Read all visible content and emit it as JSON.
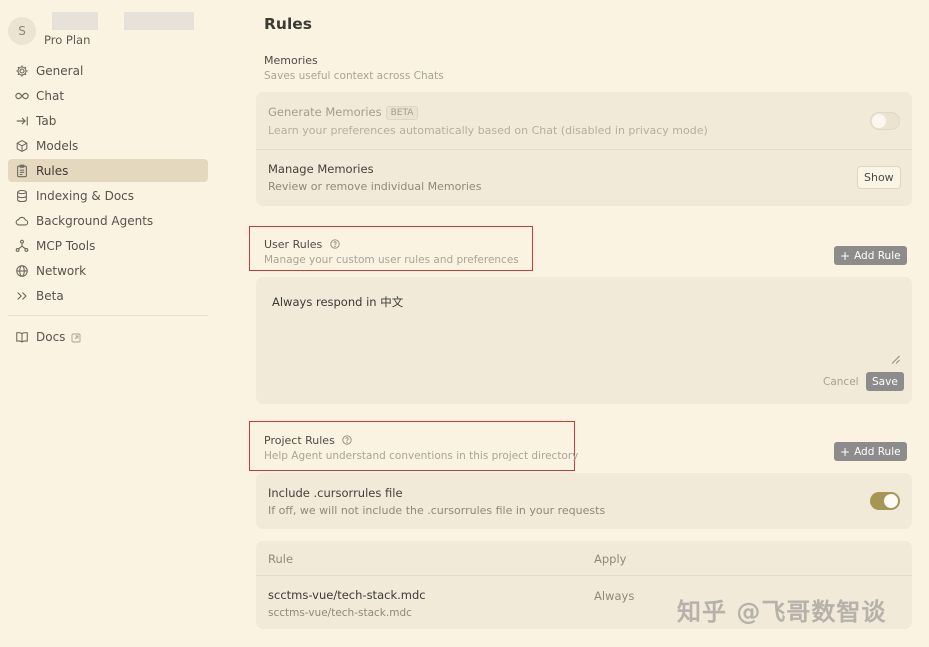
{
  "sidebar": {
    "avatar_letter": "S",
    "plan": "Pro Plan",
    "items": [
      {
        "label": "General",
        "icon": "gear-icon"
      },
      {
        "label": "Chat",
        "icon": "infinity-icon"
      },
      {
        "label": "Tab",
        "icon": "arrow-right-bar-icon"
      },
      {
        "label": "Models",
        "icon": "cube-icon"
      },
      {
        "label": "Rules",
        "icon": "clipboard-icon",
        "active": true
      },
      {
        "label": "Indexing & Docs",
        "icon": "database-icon"
      },
      {
        "label": "Background Agents",
        "icon": "cloud-icon"
      },
      {
        "label": "MCP Tools",
        "icon": "network-nodes-icon"
      },
      {
        "label": "Network",
        "icon": "globe-icon"
      },
      {
        "label": "Beta",
        "icon": "double-chevron-right-icon"
      }
    ],
    "docs_label": "Docs"
  },
  "page_title": "Rules",
  "memories": {
    "title": "Memories",
    "desc": "Saves useful context across Chats",
    "generate_title": "Generate Memories",
    "generate_badge": "BETA",
    "generate_desc": "Learn your preferences automatically based on Chat (disabled in privacy mode)",
    "generate_enabled": false,
    "manage_title": "Manage Memories",
    "manage_desc": "Review or remove individual Memories",
    "show_label": "Show"
  },
  "user_rules": {
    "title": "User Rules",
    "desc": "Manage your custom user rules and preferences",
    "add_label": "Add Rule",
    "content": "Always respond in 中文",
    "cancel_label": "Cancel",
    "save_label": "Save"
  },
  "project_rules": {
    "title": "Project Rules",
    "desc": "Help Agent understand conventions in this project directory",
    "add_label": "Add Rule",
    "include_title": "Include .cursorrules file",
    "include_desc": "If off, we will not include the .cursorrules file in your requests",
    "include_enabled": true,
    "table": {
      "col_rule": "Rule",
      "col_apply": "Apply",
      "rows": [
        {
          "name": "scctms-vue/tech-stack.mdc",
          "path": "scctms-vue/tech-stack.mdc",
          "apply": "Always"
        }
      ]
    }
  },
  "watermark": "知乎 @飞哥数智谈",
  "colors": {
    "background": "#fbf3e1",
    "card": "#f1ead8",
    "active_nav": "#e4d9bf",
    "toggle_on": "#a49654",
    "annotation_red": "#d13a3a"
  }
}
